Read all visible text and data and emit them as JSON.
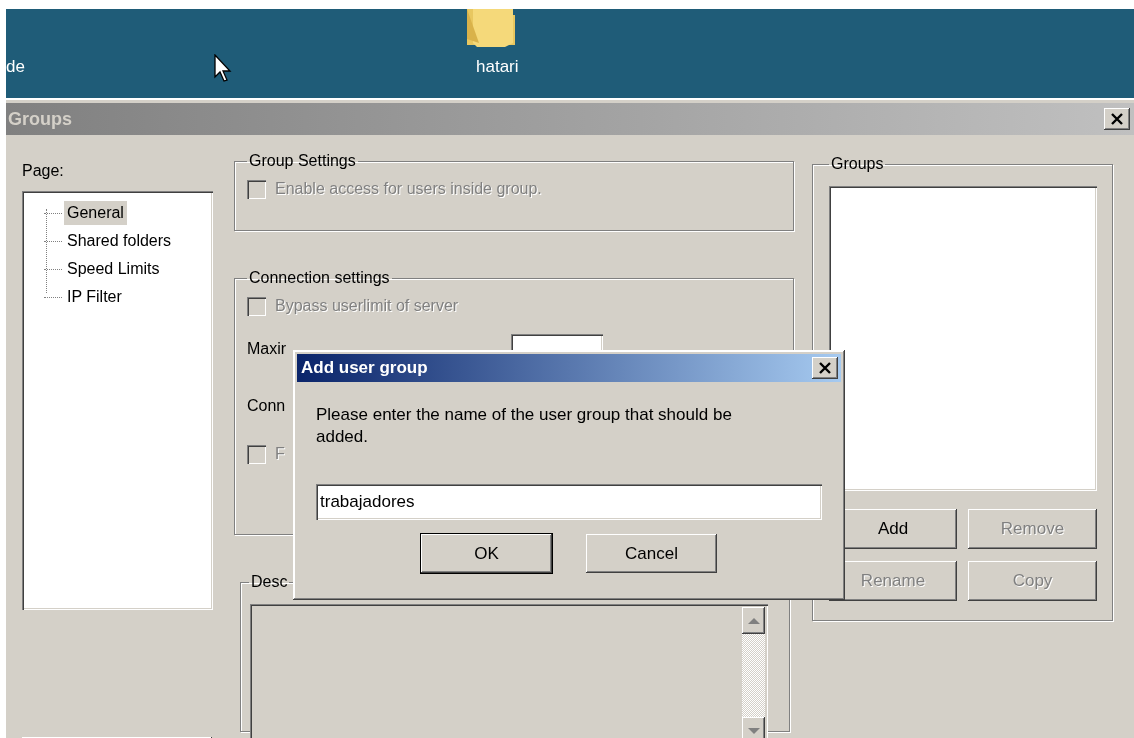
{
  "desktop": {
    "icons": [
      {
        "label": "de",
        "kind": "text"
      },
      {
        "label": "hatari",
        "kind": "folder"
      }
    ]
  },
  "window": {
    "title": "Groups"
  },
  "page_tree": {
    "label": "Page:",
    "items": [
      {
        "label": "General",
        "selected": true
      },
      {
        "label": "Shared folders",
        "selected": false
      },
      {
        "label": "Speed Limits",
        "selected": false
      },
      {
        "label": "IP Filter",
        "selected": false
      }
    ]
  },
  "group_settings": {
    "title": "Group Settings",
    "rows": [
      {
        "kind": "checkbox",
        "label": "Enable access for users inside group.",
        "checked": false,
        "disabled": true
      }
    ]
  },
  "connection_settings": {
    "title": "Connection settings",
    "rows": [
      {
        "kind": "checkbox",
        "label": "Bypass userlimit of server",
        "checked": false,
        "disabled": true
      },
      {
        "kind": "field",
        "label": "Maxir"
      },
      {
        "kind": "text",
        "label": "Conn"
      },
      {
        "kind": "checkbox",
        "label": "F",
        "checked": false,
        "disabled": true
      }
    ]
  },
  "description": {
    "title": "Desc"
  },
  "groups": {
    "title": "Groups",
    "buttons": [
      {
        "label": "Add",
        "disabled": false
      },
      {
        "label": "Remove",
        "disabled": true
      },
      {
        "label": "Rename",
        "disabled": true
      },
      {
        "label": "Copy",
        "disabled": true
      }
    ]
  },
  "dialog": {
    "title": "Add user group",
    "message": "Please enter the name of the user group that should be added.",
    "value": "trabajadores",
    "buttons": [
      {
        "label": "OK",
        "default": true
      },
      {
        "label": "Cancel",
        "default": false
      }
    ]
  }
}
